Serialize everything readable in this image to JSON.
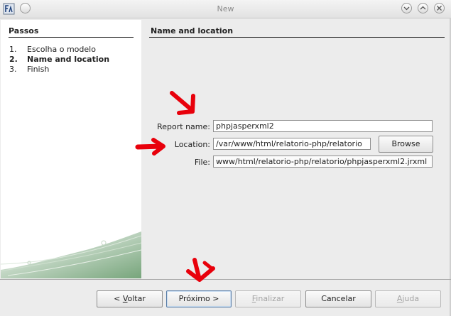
{
  "window": {
    "title": "New"
  },
  "steps": {
    "title": "Passos",
    "items": [
      {
        "num": "1.",
        "label": "Escolha o modelo"
      },
      {
        "num": "2.",
        "label": "Name and location"
      },
      {
        "num": "3.",
        "label": "Finish"
      }
    ]
  },
  "panel": {
    "title": "Name and location",
    "report_name_label": "Report name:",
    "report_name_value": "phpjasperxml2",
    "location_label": "Location:",
    "location_value": "/var/www/html/relatorio-php/relatorio",
    "browse_label": "Browse",
    "file_label": "File:",
    "file_value": "www/html/relatorio-php/relatorio/phpjasperxml2.jrxml"
  },
  "buttons": {
    "back": {
      "prefix": "< ",
      "mnemonic": "V",
      "rest": "oltar"
    },
    "next": "Próximo >",
    "finish": {
      "mnemonic": "F",
      "rest": "inalizar"
    },
    "cancel": "Cancelar",
    "help": {
      "mnemonic": "A",
      "rest": "juda"
    }
  },
  "colors": {
    "annotation": "#e8000b",
    "default_border": "#5a7ea8"
  }
}
